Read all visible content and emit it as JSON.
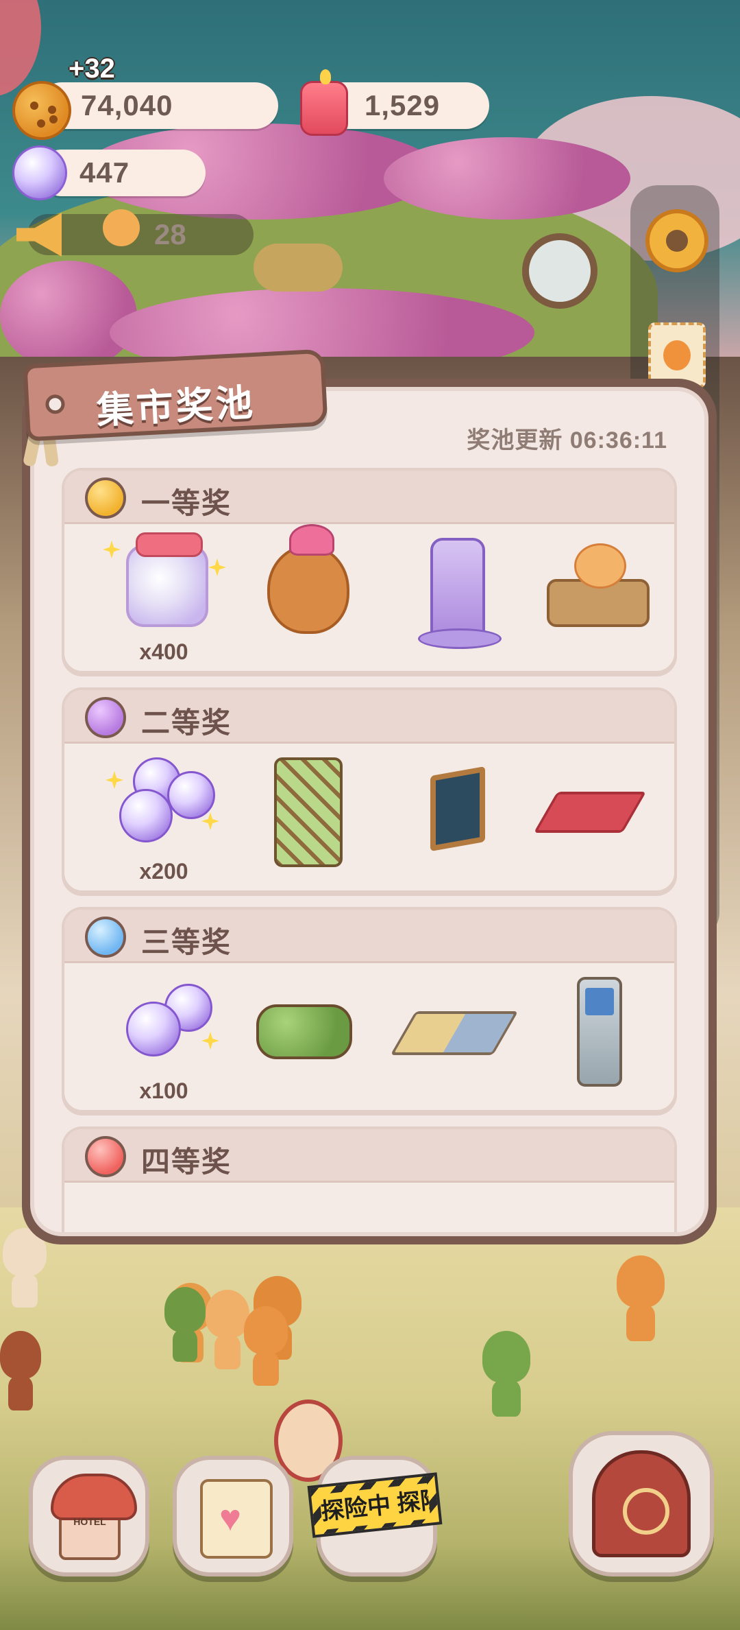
{
  "hud": {
    "gain_popup": "+32",
    "cookies": "74,040",
    "candles": "1,529",
    "candy": "447",
    "visitors": "28"
  },
  "dialog": {
    "title": "集市奖池",
    "refresh_label": "奖池更新 06:36:11",
    "tiers": [
      {
        "title": "一等奖",
        "dot_color": "#f2b22e",
        "items": [
          {
            "icon": "candy-jar-icon",
            "qty": "x400"
          },
          {
            "icon": "teddy-bear-icon",
            "qty": ""
          },
          {
            "icon": "cat-tower-icon",
            "qty": ""
          },
          {
            "icon": "cake-cart-icon",
            "qty": ""
          }
        ]
      },
      {
        "title": "二等奖",
        "dot_color": "#b77be0",
        "items": [
          {
            "icon": "candy-pile-icon",
            "qty": "x200"
          },
          {
            "icon": "vine-trellis-icon",
            "qty": ""
          },
          {
            "icon": "picture-frames-icon",
            "qty": ""
          },
          {
            "icon": "red-rug-icon",
            "qty": ""
          }
        ]
      },
      {
        "title": "三等奖",
        "dot_color": "#6fb6f2",
        "items": [
          {
            "icon": "candy-pair-icon",
            "qty": "x100"
          },
          {
            "icon": "flower-planter-icon",
            "qty": ""
          },
          {
            "icon": "puzzle-mat-icon",
            "qty": ""
          },
          {
            "icon": "phone-board-icon",
            "qty": ""
          }
        ]
      },
      {
        "title": "四等奖",
        "dot_color": "#f0625e",
        "items": []
      }
    ]
  },
  "bottom": {
    "hotel_label": "HOTEL",
    "explore_label": "探险中 探险"
  },
  "icons": {
    "cookie": "cookie-currency-icon",
    "candle": "candle-currency-icon",
    "candy": "candy-currency-icon",
    "megaphone": "megaphone-icon",
    "settings": "gear-icon"
  }
}
